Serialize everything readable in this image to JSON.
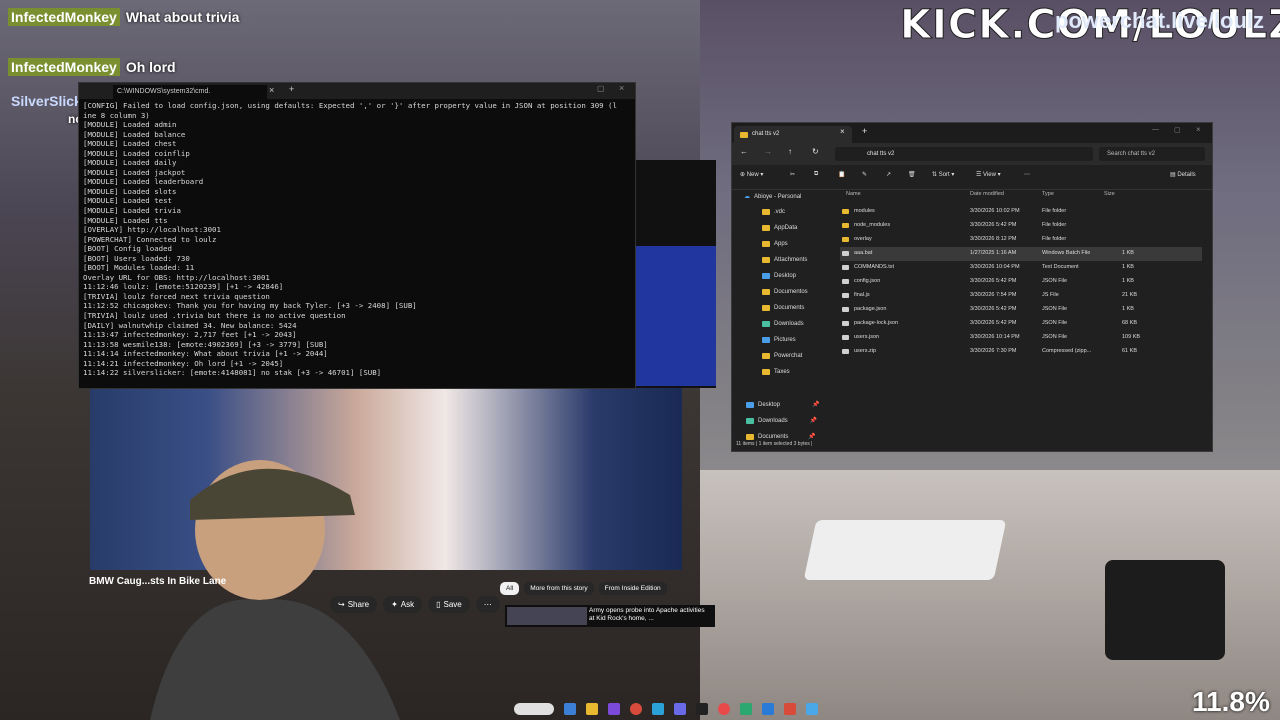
{
  "stream": {
    "banner": "KICK.COM/LOULZ",
    "powerchat_tag": "powerchat.live/loulz",
    "percentage": "11.8%"
  },
  "chat": [
    {
      "user": "InfectedMonkey",
      "message": "What about trivia"
    },
    {
      "user": "InfectedMonkey",
      "message": "Oh lord"
    },
    {
      "user": "SilverSlicker",
      "message": "no stak"
    }
  ],
  "cmd": {
    "tab_title": "C:\\WINDOWS\\system32\\cmd.",
    "lines": [
      "[CONFIG] Failed to load config.json, using defaults: Expected ',' or '}' after property value in JSON at position 309 (l",
      "ine 8 column 3)",
      "[MODULE] Loaded admin",
      "[MODULE] Loaded balance",
      "[MODULE] Loaded chest",
      "[MODULE] Loaded coinflip",
      "[MODULE] Loaded daily",
      "[MODULE] Loaded jackpot",
      "[MODULE] Loaded leaderboard",
      "[MODULE] Loaded slots",
      "[MODULE] Loaded test",
      "[MODULE] Loaded trivia",
      "[MODULE] Loaded tts",
      "[OVERLAY] http://localhost:3001",
      "[POWERCHAT] Connected to loulz",
      "[BOOT] Config loaded",
      "[BOOT] Users loaded: 730",
      "[BOOT] Modules loaded: 11",
      "Overlay URL for OBS: http://localhost:3001",
      "11:12:46 loulz: [emote:5120239] [+1 -> 42846]",
      "[TRIVIA] loulz forced next trivia question",
      "11:12:52 chicagokev: Thank you for having my back Tyler. [+3 -> 2408] [SUB]",
      "[TRIVIA] loulz used .trivia but there is no active question",
      "[DAILY] walnutwhip claimed 34. New balance: 5424",
      "11:13:47 infectedmonkey: 2,717 feet [+1 -> 2043]",
      "11:13:58 wesmile138: [emote:4902369] [+3 -> 3779] [SUB]",
      "11:14:14 infectedmonkey: What about trivia [+1 -> 2044]",
      "11:14:21 infectedmonkey: Oh lord [+1 -> 2045]",
      "11:14:22 silverslicker: [emote:4148081] no stak [+3 -> 46701] [SUB]"
    ]
  },
  "youtube": {
    "title": "BMW Caug...sts In Bike Lane",
    "actions": [
      "Share",
      "Ask",
      "Save",
      "⋯"
    ],
    "chips": [
      "All",
      "More from this story",
      "From Inside Edition"
    ],
    "recommendation": "Army opens probe into Apache activities at Kid Rock's home, ..."
  },
  "explorer": {
    "tab_title": "chat tts v2",
    "path": "chat tts v2",
    "search_placeholder": "Search chat tts v2",
    "toolbar": [
      "New",
      "Sort",
      "View",
      "Details"
    ],
    "nav_root": "Abioye - Personal",
    "nav_items": [
      ".vdc",
      "AppData",
      "Apps",
      "Attachments",
      "Desktop",
      "Documentos",
      "Documents",
      "Downloads",
      "Pictures",
      "Powerchat",
      "Taxes"
    ],
    "quick_access": [
      "Desktop",
      "Downloads",
      "Documents"
    ],
    "columns": [
      "Name",
      "Date modified",
      "Type",
      "Size"
    ],
    "files": [
      {
        "name": "modules",
        "date": "3/30/2026 10:02 PM",
        "type": "File folder",
        "size": ""
      },
      {
        "name": "node_modules",
        "date": "3/30/2026 5:42 PM",
        "type": "File folder",
        "size": ""
      },
      {
        "name": "overlay",
        "date": "3/30/2026 8:12 PM",
        "type": "File folder",
        "size": ""
      },
      {
        "name": "aaa.bat",
        "date": "1/27/2025 1:16 AM",
        "type": "Windows Batch File",
        "size": "1 KB"
      },
      {
        "name": "COMMANDS.txt",
        "date": "3/30/2026 10:04 PM",
        "type": "Text Document",
        "size": "1 KB"
      },
      {
        "name": "config.json",
        "date": "3/30/2026 5:42 PM",
        "type": "JSON File",
        "size": "1 KB"
      },
      {
        "name": "final.js",
        "date": "3/30/2026 7:54 PM",
        "type": "JS File",
        "size": "21 KB"
      },
      {
        "name": "package.json",
        "date": "3/30/2026 5:42 PM",
        "type": "JSON File",
        "size": "1 KB"
      },
      {
        "name": "package-lock.json",
        "date": "3/30/2026 5:42 PM",
        "type": "JSON File",
        "size": "68 KB"
      },
      {
        "name": "users.json",
        "date": "3/30/2026 10:14 PM",
        "type": "JSON File",
        "size": "109 KB"
      },
      {
        "name": "users.zip",
        "date": "3/30/2026 7:30 PM",
        "type": "Compressed (zipp...",
        "size": "61 KB"
      }
    ],
    "status": "11 items  |  1 item selected 3 bytes  |"
  },
  "colors": {
    "chat_name_bg": "#7a8f30",
    "folder": "#e8b830",
    "explorer_bg": "#202020",
    "terminal_bg": "#0c0c0c"
  }
}
